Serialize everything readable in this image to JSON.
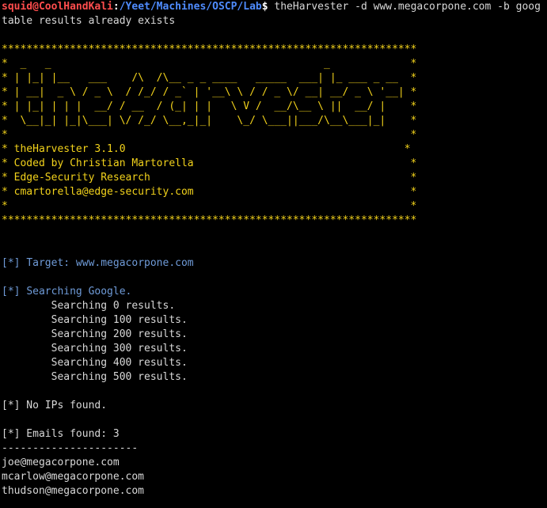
{
  "colors": {
    "background": "#000000",
    "text": "#d8d8d8",
    "prompt_user": "#ff4d4d",
    "prompt_path": "#4f8cff",
    "banner": "#f2d21b",
    "info": "#6f9bd8"
  },
  "prompt": {
    "user_host": "squid@CoolHandKali",
    "separator": ":",
    "path": "/Yeet/Machines/OSCP/Lab",
    "symbol": "$",
    "command": " theHarvester -d www.megacorpone.com -b goog"
  },
  "warning": "table results already exists",
  "banner": {
    "border": "*******************************************************************",
    "art": [
      "*  _   _                                            _             *",
      "* | |_| |__   ___    /\\  /\\__ _ _ ____   _____  ___| |_ ___ _ __  *",
      "* | __|  _ \\ / _ \\  / /_/ / _` | '__\\ \\ / / _ \\/ __| __/ _ \\ '__| *",
      "* | |_| | | |  __/ / __  / (_| | |   \\ V /  __/\\__ \\ ||  __/ |    *",
      "*  \\__|_| |_|\\___| \\/ /_/ \\__,_|_|    \\_/ \\___||___/\\__\\___|_|    *",
      "*                                                                 *"
    ],
    "info_lines": [
      "* theHarvester 3.1.0                                             *",
      "* Coded by Christian Martorella                                   *",
      "* Edge-Security Research                                          *",
      "* cmartorella@edge-security.com                                   *",
      "*                                                                 *"
    ]
  },
  "output": {
    "target_prefix": "[*] ",
    "target_label": "Target: www.megacorpone.com",
    "search_prefix": "[*] ",
    "search_label": "Searching Google.",
    "search_progress": [
      "        Searching 0 results.",
      "        Searching 100 results.",
      "        Searching 200 results.",
      "        Searching 300 results.",
      "        Searching 400 results.",
      "        Searching 500 results."
    ],
    "no_ips": "[*] No IPs found.",
    "emails_found": "[*] Emails found: 3",
    "separator": "----------------------",
    "emails": [
      "joe@megacorpone.com",
      "mcarlow@megacorpone.com",
      "thudson@megacorpone.com"
    ]
  }
}
